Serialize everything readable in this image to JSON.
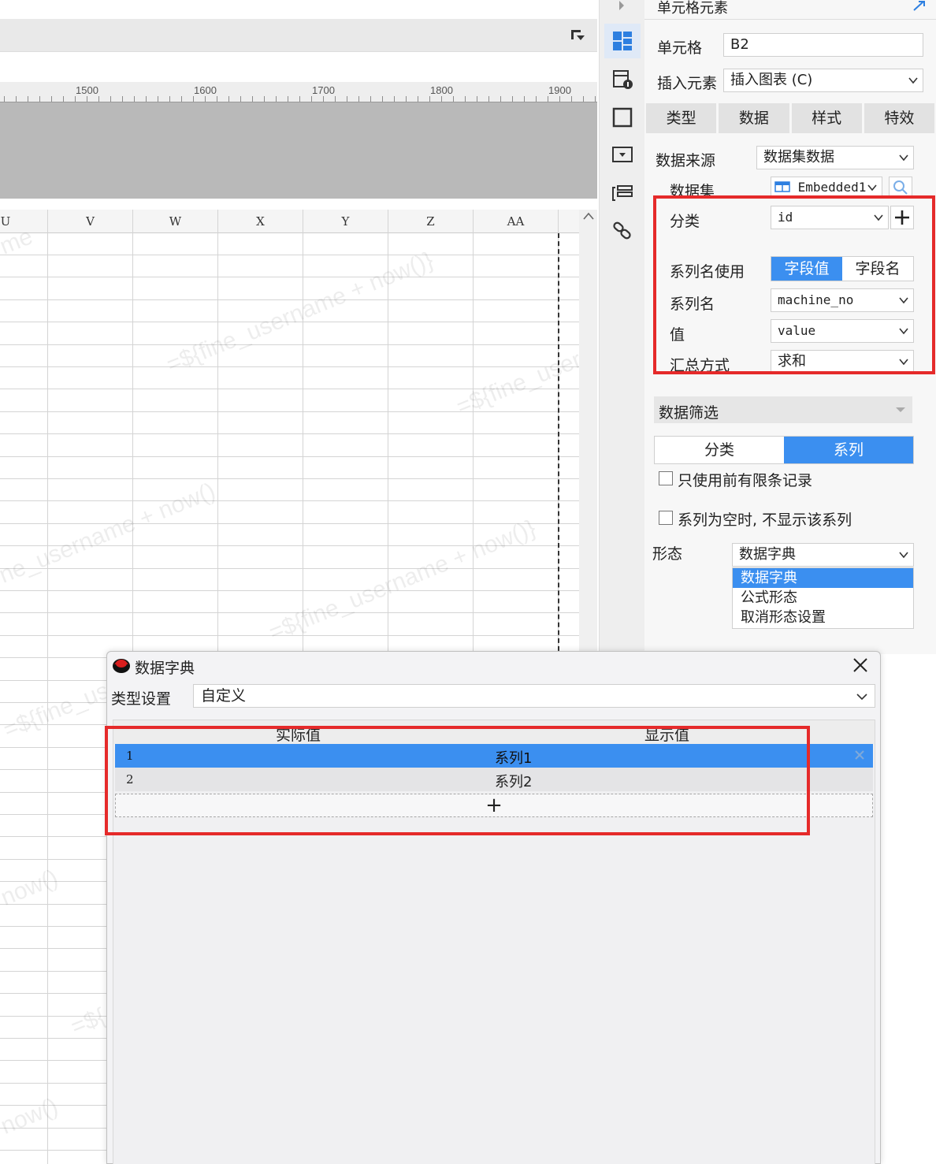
{
  "ruler": {
    "labels": [
      "1500",
      "1600",
      "1700",
      "1800",
      "1900"
    ]
  },
  "columns": [
    "U",
    "V",
    "W",
    "X",
    "Y",
    "Z",
    "AA"
  ],
  "watermark": {
    "texts": [
      "=${fine_username + now()}",
      "=${fine_user",
      "me",
      "ne_username + now()",
      "=${fine_username + now()}",
      "now()",
      "=${fine_user",
      "now()",
      "=${"
    ]
  },
  "panel": {
    "title": "单元格元素",
    "cell_label": "单元格",
    "cell_value": "B2",
    "insert_label": "插入元素",
    "insert_value": "插入图表 (C)",
    "tabs": [
      "类型",
      "数据",
      "样式",
      "特效"
    ],
    "datasource_label": "数据来源",
    "datasource_value": "数据集数据",
    "dataset_label": "数据集",
    "dataset_value": "Embedded1",
    "category_label": "分类",
    "category_value": "id",
    "series_name_use_label": "系列名使用",
    "series_name_use_options": [
      "字段值",
      "字段名"
    ],
    "series_name_label": "系列名",
    "series_name_value": "machine_no",
    "value_label": "值",
    "value_value": "value",
    "summary_label": "汇总方式",
    "summary_value": "求和",
    "filter_label": "数据筛选",
    "filter_tabs": [
      "分类",
      "系列"
    ],
    "checkbox_1": "只使用前有限条记录",
    "checkbox_2": "系列为空时, 不显示该系列",
    "form_label": "形态",
    "form_value": "数据字典",
    "form_options": [
      "数据字典",
      "公式形态",
      "取消形态设置"
    ]
  },
  "dialog": {
    "title": "数据字典",
    "type_label": "类型设置",
    "type_value": "自定义",
    "headers": [
      "实际值",
      "显示值"
    ],
    "rows": [
      {
        "actual": "1",
        "display": "系列1"
      },
      {
        "actual": "2",
        "display": "系列2"
      }
    ],
    "add_label": "+"
  },
  "colors": {
    "accent": "#3b8ff0",
    "highlight_box": "#e52a2a"
  }
}
